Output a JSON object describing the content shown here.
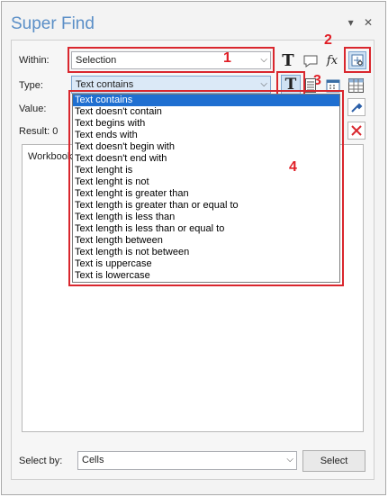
{
  "window": {
    "title": "Super Find",
    "pin_glyph": "▾",
    "close_glyph": "✕"
  },
  "within": {
    "label": "Within:",
    "value": "Selection"
  },
  "type": {
    "label": "Type:",
    "value": "Text contains"
  },
  "value": {
    "label": "Value:"
  },
  "result": {
    "label": "Result: 0"
  },
  "results_panel": {
    "first_row": "Workbook"
  },
  "dropdown": {
    "items": [
      "Text contains",
      "Text doesn't contain",
      "Text begins with",
      "Text ends with",
      "Text doesn't begin with",
      "Text doesn't end with",
      "Text lenght is",
      "Text lenght is not",
      "Text lenght is greater than",
      "Text length is greater than or equal to",
      "Text length is less than",
      "Text length is less than or equal to",
      "Text length between",
      "Text length is not between",
      "Text is uppercase",
      "Text is lowercase"
    ],
    "selected_index": 0
  },
  "select_by": {
    "label": "Select by:",
    "value": "Cells",
    "button_label": "Select"
  },
  "annotations": {
    "n1": "1",
    "n2": "2",
    "n3": "3",
    "n4": "4"
  },
  "icons": {
    "text_type": "T",
    "comment": "comment-icon",
    "formula": "fx",
    "hyperlink": "hyperlink-icon",
    "date": "calendar-icon",
    "number": "number-icon",
    "table": "table-icon",
    "eyedropper": "eyedropper-icon",
    "clear": "clear-icon"
  },
  "colors": {
    "accent": "#5b8fc7",
    "highlight": "#d9272e",
    "selection": "#1f6fd1"
  }
}
